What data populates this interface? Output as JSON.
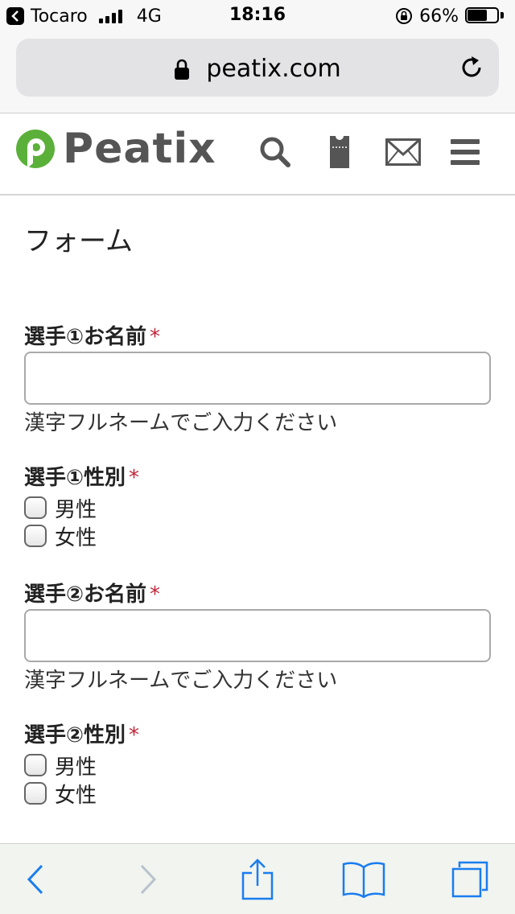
{
  "status_bar": {
    "carrier": "Tocaro",
    "network": "4G",
    "time": "18:16",
    "battery_text": "66%",
    "battery_level": 0.66
  },
  "browser": {
    "url": "peatix.com"
  },
  "site": {
    "logo_text": "Peatix",
    "brand_color": "#5bb03a"
  },
  "form": {
    "title": "フォーム",
    "required_mark": "*",
    "fields": [
      {
        "label": "選手①お名前",
        "value": "",
        "hint": "漢字フルネームでご入力ください"
      },
      {
        "label": "選手①性別",
        "options": [
          "男性",
          "女性"
        ]
      },
      {
        "label": "選手②お名前",
        "value": "",
        "hint": "漢字フルネームでご入力ください"
      },
      {
        "label": "選手②性別",
        "options": [
          "男性",
          "女性"
        ]
      }
    ]
  },
  "colors": {
    "required": "#c0263a",
    "ios_blue": "#1a7cf0",
    "icon_gray": "#555555"
  }
}
